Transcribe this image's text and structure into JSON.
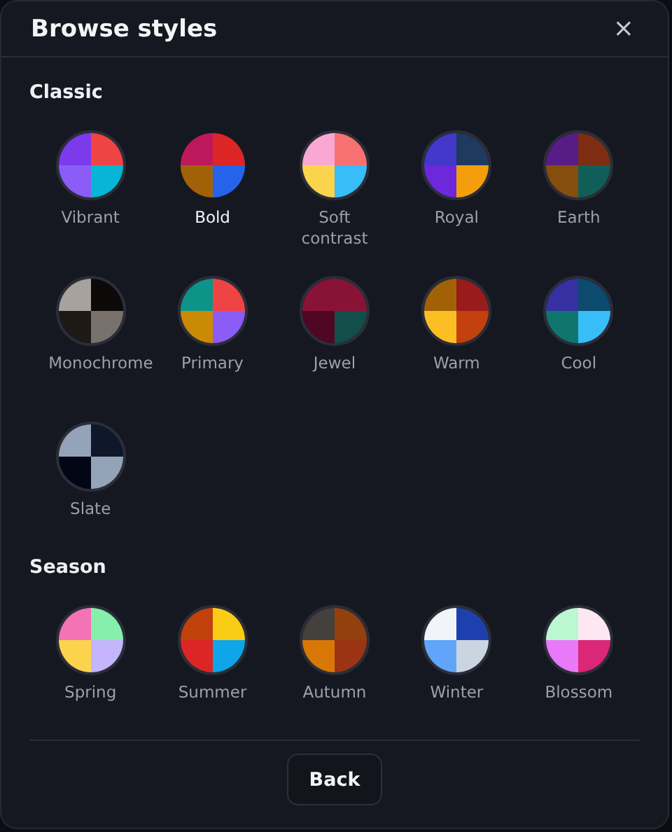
{
  "dialog": {
    "title": "Browse styles",
    "close": "×"
  },
  "sections": [
    {
      "heading": "Classic",
      "items": [
        {
          "label": "Vibrant",
          "selected": false,
          "quadrants": [
            {
              "color": "#7c3aed"
            },
            {
              "color": "#ef4444"
            },
            {
              "color": "#8b5cf6"
            },
            {
              "color": "#06b6d4"
            }
          ]
        },
        {
          "label": "Bold",
          "selected": true,
          "quadrants": [
            {
              "color": "#be185d"
            },
            {
              "color": "#dc2626"
            },
            {
              "color": "#a16207"
            },
            {
              "color": "#2563eb"
            }
          ]
        },
        {
          "label": "Soft contrast",
          "selected": false,
          "quadrants": [
            {
              "color": "#f9a8d4"
            },
            {
              "color": "#f87171"
            },
            {
              "color": "#fcd34d"
            },
            {
              "color": "#38bdf8"
            }
          ]
        },
        {
          "label": "Royal",
          "selected": false,
          "quadrants": [
            {
              "color": "#4338ca"
            },
            {
              "color": "#1e3a5f"
            },
            {
              "color": "#6d28d9"
            },
            {
              "color": "#f59e0b"
            }
          ]
        },
        {
          "label": "Earth",
          "selected": false,
          "quadrants": [
            {
              "color": "#581c87"
            },
            {
              "color": "#7c2d12"
            },
            {
              "color": "#854d0e"
            },
            {
              "color": "#115e59"
            }
          ]
        },
        {
          "label": "Monochrome",
          "selected": false,
          "quadrants": [
            {
              "color": "#a8a29e"
            },
            {
              "color": "#0c0a09"
            },
            {
              "color": "#1c1917"
            },
            {
              "color": "#78716c"
            }
          ]
        },
        {
          "label": "Primary",
          "selected": false,
          "quadrants": [
            {
              "color": "#0d9488"
            },
            {
              "color": "#ef4444"
            },
            {
              "color": "#ca8a04"
            },
            {
              "color": "#8b5cf6"
            }
          ]
        },
        {
          "label": "Jewel",
          "selected": false,
          "quadrants": [
            {
              "color": "#881337"
            },
            {
              "color": "#881337"
            },
            {
              "color": "#500724"
            },
            {
              "color": "#134e4a"
            }
          ]
        },
        {
          "label": "Warm",
          "selected": false,
          "quadrants": [
            {
              "color": "#a16207"
            },
            {
              "color": "#991b1b"
            },
            {
              "color": "#fbbf24"
            },
            {
              "color": "#c2410c"
            }
          ]
        },
        {
          "label": "Cool",
          "selected": false,
          "quadrants": [
            {
              "color": "#3730a3"
            },
            {
              "color": "#0c4a6e"
            },
            {
              "color": "#0f766e"
            },
            {
              "color": "#38bdf8"
            }
          ]
        },
        {
          "label": "Slate",
          "selected": false,
          "quadrants": [
            {
              "color": "#94a3b8"
            },
            {
              "color": "#0f172a"
            },
            {
              "color": "#020617"
            },
            {
              "color": "#94a3b8"
            }
          ]
        }
      ]
    },
    {
      "heading": "Season",
      "items": [
        {
          "label": "Spring",
          "selected": false,
          "quadrants": [
            {
              "color": "#f472b6"
            },
            {
              "color": "#86efac"
            },
            {
              "color": "#fcd34d"
            },
            {
              "color": "#c4b5fd"
            }
          ]
        },
        {
          "label": "Summer",
          "selected": false,
          "quadrants": [
            {
              "color": "#c2410c"
            },
            {
              "color": "#facc15"
            },
            {
              "color": "#dc2626"
            },
            {
              "color": "#0ea5e9"
            }
          ]
        },
        {
          "label": "Autumn",
          "selected": false,
          "quadrants": [
            {
              "color": "#44403c"
            },
            {
              "color": "#92400e"
            },
            {
              "color": "#d97706"
            },
            {
              "color": "#9a3412"
            }
          ]
        },
        {
          "label": "Winter",
          "selected": false,
          "quadrants": [
            {
              "color": "#f1f5f9"
            },
            {
              "color": "#1e40af"
            },
            {
              "color": "#60a5fa"
            },
            {
              "color": "#cbd5e1"
            }
          ]
        },
        {
          "label": "Blossom",
          "selected": false,
          "quadrants": [
            {
              "color": "#bbf7d0"
            },
            {
              "color": "#fce7f3"
            },
            {
              "color": "#e879f9"
            },
            {
              "color": "#db2777"
            }
          ]
        }
      ]
    }
  ],
  "footer": {
    "button": "Back"
  }
}
